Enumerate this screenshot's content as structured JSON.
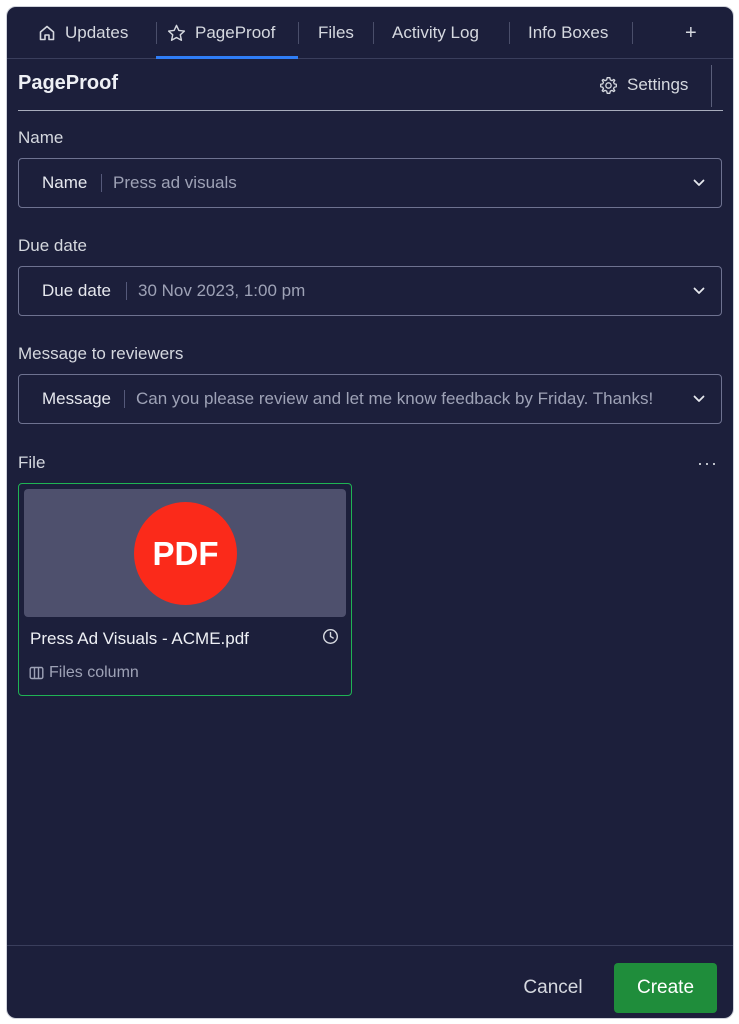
{
  "tabs": {
    "items": [
      {
        "label": "Updates",
        "icon": "home-icon"
      },
      {
        "label": "PageProof",
        "icon": "star-icon",
        "active": true
      },
      {
        "label": "Files"
      },
      {
        "label": "Activity Log"
      },
      {
        "label": "Info Boxes"
      }
    ],
    "add_label": "+"
  },
  "header": {
    "title": "PageProof",
    "settings_label": "Settings",
    "settings_icon": "gear-icon"
  },
  "form": {
    "name": {
      "label": "Name",
      "key": "Name",
      "value": "Press ad visuals"
    },
    "due_date": {
      "label": "Due date",
      "key": "Due date",
      "value": "30 Nov 2023, 1:00 pm"
    },
    "message": {
      "label": "Message to reviewers",
      "key": "Message",
      "value": "Can you please review and let me know feedback by Friday. Thanks!"
    }
  },
  "file": {
    "label": "File",
    "more_label": "···",
    "badge": "PDF",
    "name": "Press Ad Visuals - ACME.pdf",
    "source": "Files column"
  },
  "footer": {
    "cancel_label": "Cancel",
    "create_label": "Create"
  },
  "colors": {
    "background": "#1c1f3b",
    "accent_tab": "#2f7df6",
    "create_button": "#1f8d3b",
    "file_border": "#1fb354",
    "pdf_badge": "#fb2a1a"
  }
}
